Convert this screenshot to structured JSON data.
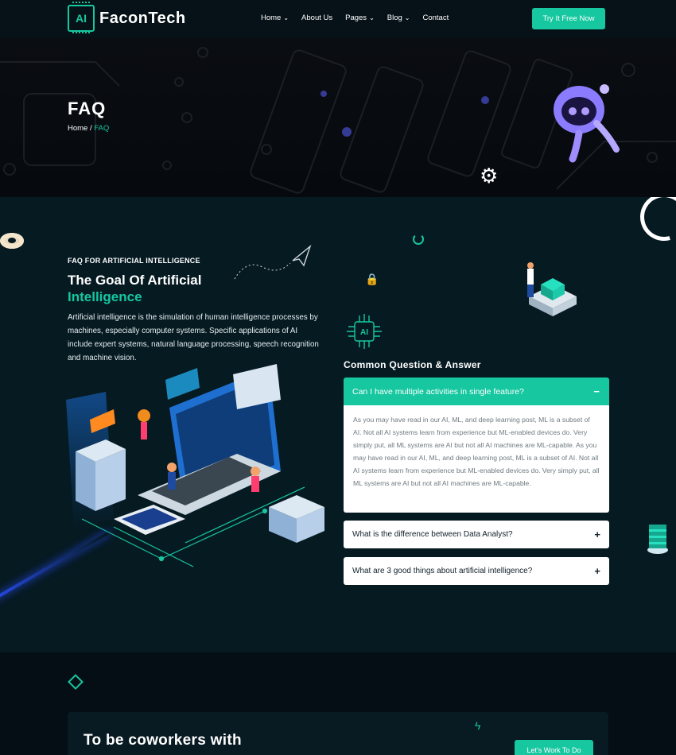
{
  "brand": {
    "logo_badge": "AI",
    "name": "FaconTech"
  },
  "nav": {
    "items": [
      {
        "label": "Home",
        "has_dropdown": true
      },
      {
        "label": "About Us",
        "has_dropdown": false
      },
      {
        "label": "Pages",
        "has_dropdown": true
      },
      {
        "label": "Blog",
        "has_dropdown": true
      },
      {
        "label": "Contact",
        "has_dropdown": false
      }
    ],
    "chevron": "⌄",
    "cta_label": "Try It Free Now"
  },
  "hero": {
    "title": "FAQ",
    "breadcrumb": {
      "home": "Home",
      "separator": " / ",
      "current": "FAQ"
    }
  },
  "faq_intro": {
    "eyebrow": "FAQ FOR ARTIFICIAL INTELLIGENCE",
    "heading_line1": "The Goal Of Artificial",
    "heading_line2": "Intelligence",
    "body": "Artificial intelligence is the simulation of human intelligence processes by machines, especially computer systems. Specific applications of AI include expert systems, natural language processing, speech recognition and machine vision."
  },
  "qa": {
    "icon_badge": "AI",
    "title": "Common Question & Answer",
    "items": [
      {
        "question": "Can I have multiple activities in single feature?",
        "expanded": true,
        "icon": "−",
        "answer": "As you may have read in our AI, ML, and deep learning post, ML is a subset of AI. Not all AI systems learn from experience but ML-enabled devices do. Very simply put, all ML systems are AI but not all AI machines are ML-capable. As you may have read in our AI, ML, and deep learning post, ML is a subset of AI. Not all AI systems learn from experience but ML-enabled devices do. Very simply put, all ML systems are AI but not all AI machines are ML-capable."
      },
      {
        "question": "What is the difference between Data Analyst?",
        "expanded": false,
        "icon": "+"
      },
      {
        "question": "What are 3 good things about artificial intelligence?",
        "expanded": false,
        "icon": "+"
      }
    ]
  },
  "coworkers": {
    "title": "To be coworkers with",
    "cta_label": "Let's Work To Do"
  },
  "colors": {
    "accent": "#16c7a0",
    "background": "#061a22",
    "header": "#071218"
  }
}
